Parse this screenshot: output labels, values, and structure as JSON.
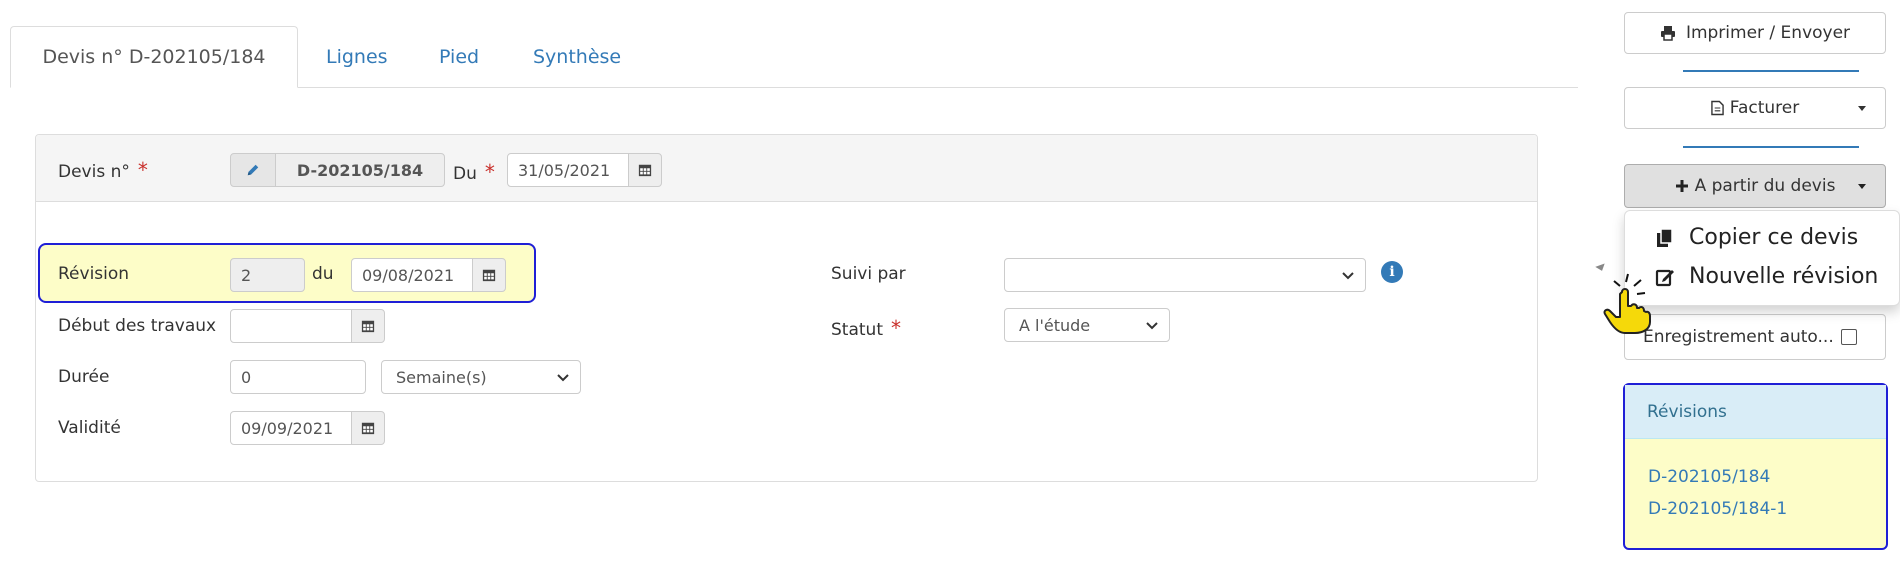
{
  "tabs": [
    {
      "label": "Devis n° D-202105/184"
    },
    {
      "label": "Lignes"
    },
    {
      "label": "Pied"
    },
    {
      "label": "Synthèse"
    }
  ],
  "header": {
    "devis_label": "Devis n°",
    "devis_number": "D-202105/184",
    "du_label": "Du",
    "du_date": "31/05/2021",
    "required_mark": "*"
  },
  "form": {
    "revision": {
      "label": "Révision",
      "value": "2",
      "du_label": "du",
      "date": "09/08/2021"
    },
    "debut": {
      "label": "Début des travaux",
      "value": ""
    },
    "duree": {
      "label": "Durée",
      "value": "0",
      "unit": "Semaine(s)"
    },
    "validite": {
      "label": "Validité",
      "value": "09/09/2021"
    },
    "suivi": {
      "label": "Suivi par",
      "value": ""
    },
    "statut": {
      "label": "Statut",
      "value": "A l'étude"
    }
  },
  "actions": {
    "print": "Imprimer / Envoyer",
    "invoice": "Facturer",
    "from_quote": "A partir du devis",
    "menu": [
      "Copier ce devis",
      "Nouvelle révision"
    ],
    "autosave": "Enregistrement auto..."
  },
  "revisions": {
    "title": "Révisions",
    "items": [
      "D-202105/184",
      "D-202105/184-1"
    ]
  },
  "colors": {
    "link": "#337ab7",
    "highlight_bg": "#fdfdc8",
    "highlight_border": "#1f1fd6",
    "required": "#c9302c"
  },
  "icons": [
    "print-icon",
    "invoice-file-icon",
    "plus-icon",
    "copy-icon",
    "edit-icon",
    "pencil-icon",
    "calendar-icon",
    "chevron-down-icon",
    "info-icon",
    "hand-cursor-icon"
  ]
}
